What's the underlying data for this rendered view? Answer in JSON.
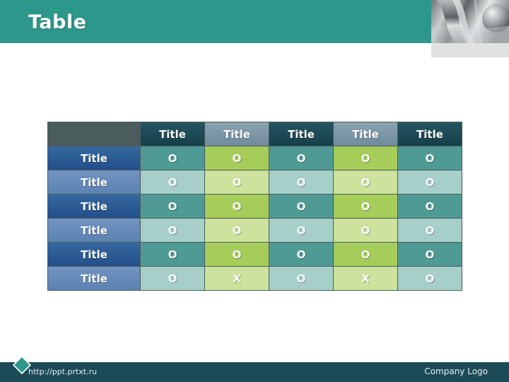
{
  "header": {
    "title": "Table",
    "bar_color": "#2e978c",
    "photo_icon": "metal-pipes-photo"
  },
  "table": {
    "columns": [
      "Title",
      "Title",
      "Title",
      "Title",
      "Title"
    ],
    "row_labels": [
      "Title",
      "Title",
      "Title",
      "Title",
      "Title",
      "Title"
    ],
    "rows": [
      [
        "O",
        "O",
        "O",
        "O",
        "O"
      ],
      [
        "O",
        "O",
        "O",
        "O",
        "O"
      ],
      [
        "O",
        "O",
        "O",
        "O",
        "O"
      ],
      [
        "O",
        "O",
        "O",
        "O",
        "O"
      ],
      [
        "O",
        "O",
        "O",
        "O",
        "O"
      ],
      [
        "O",
        "X",
        "O",
        "X",
        "O"
      ]
    ],
    "colors": {
      "header_dark": "#1e4a54",
      "header_light": "#7d98a8",
      "label_dark": "#2c5d98",
      "label_light": "#6288b8",
      "teal_dark": "#4f9a94",
      "teal_light": "#a6cfc9",
      "green_dark": "#a6cc5a",
      "green_light": "#cde29c",
      "grid": "#4a5c5c"
    }
  },
  "footer": {
    "url": "http://ppt.prtxt.ru",
    "company": "Company Logo",
    "bar_color": "#1c4a57",
    "diamond_icon": "diamond-icon"
  }
}
